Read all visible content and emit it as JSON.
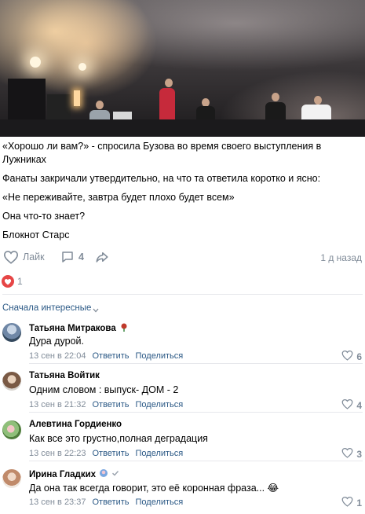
{
  "post": {
    "paragraphs": [
      "«Хорошо ли вам?» - спросила Бузова во время своего выступления в Лужниках",
      "Фанаты закричали утвердительно, на что та ответила коротко и ясно:",
      "«Не переживайте, завтра будет плохо будет всем»",
      "Она что-то знает?",
      "Блокнот Старс"
    ],
    "like_label": "Лайк",
    "comment_count": "4",
    "time_ago": "1 д назад",
    "likes_count": "1"
  },
  "comments_section": {
    "sort_label": "Сначала интересные"
  },
  "comments": [
    {
      "author": "Татьяна Митракова",
      "text": "Дура дурой.",
      "date": "13 сен в 22:04",
      "reply": "Ответить",
      "share": "Поделиться",
      "likes": "6"
    },
    {
      "author": "Татьяна Войтик",
      "text": "Одним словом : выпуск- ДОМ - 2",
      "date": "13 сен в 21:32",
      "reply": "Ответить",
      "share": "Поделиться",
      "likes": "4"
    },
    {
      "author": "Алевтина Гордиенко",
      "text": "Как все это грустно,полная деградация",
      "date": "13 сен в 22:23",
      "reply": "Ответить",
      "share": "Поделиться",
      "likes": "3"
    },
    {
      "author": "Ирина Гладких",
      "text": "Да она так всегда говорит, это её коронная фраза... 😂",
      "date": "13 сен в 23:37",
      "reply": "Ответить",
      "share": "Поделиться",
      "likes": "1"
    }
  ],
  "colors": {
    "link": "#2a5885",
    "muted": "#818c99",
    "like_heart": "#e64646",
    "divider": "#e7e8ec"
  },
  "icons": [
    "heart-outline-icon",
    "comment-icon",
    "share-icon",
    "heart-filled-icon",
    "chevron-down-icon",
    "verified-check-icon"
  ]
}
